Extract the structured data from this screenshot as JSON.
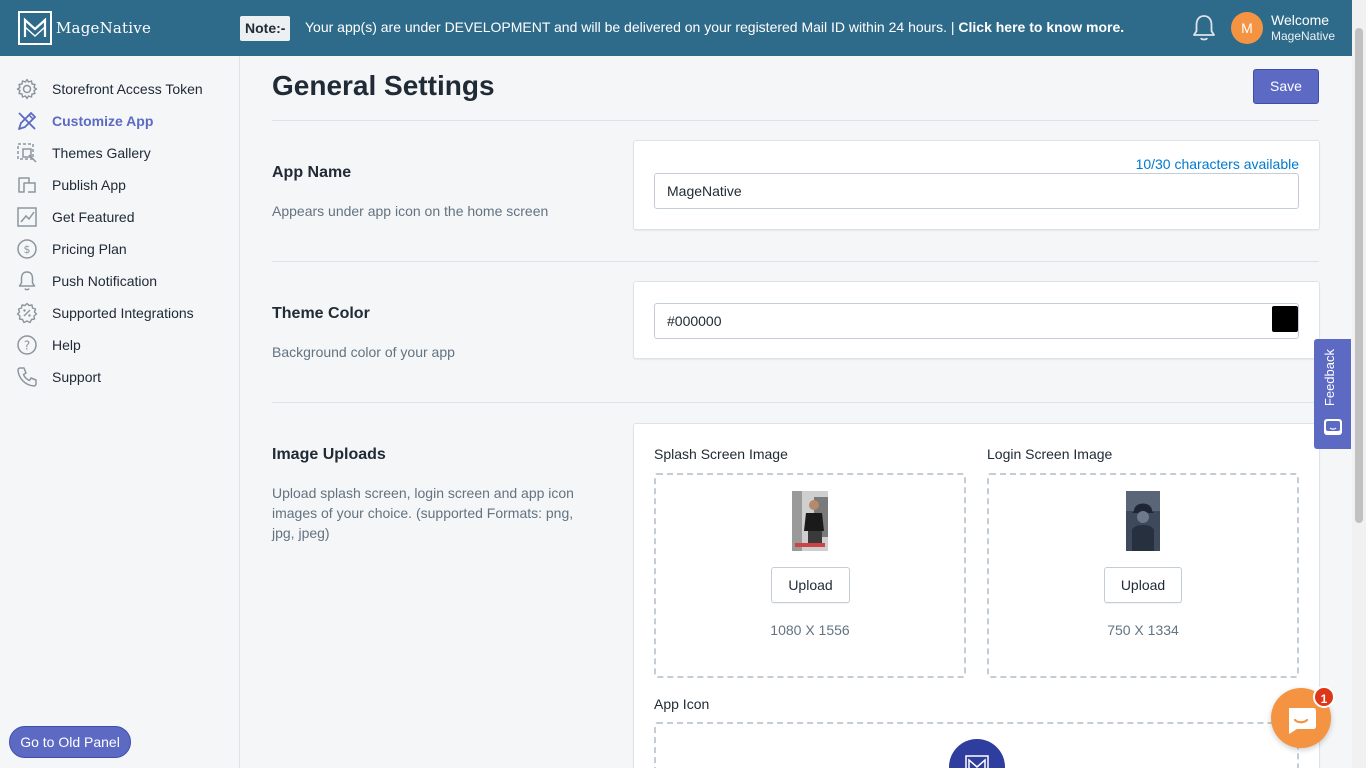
{
  "brand": {
    "logo_text": "MageNative"
  },
  "header": {
    "note_tag": "Note:-",
    "note_text": "Your app(s) are under DEVELOPMENT and will be delivered on your registered Mail ID within 24 hours. |",
    "note_link": "Click here to know more.",
    "avatar_initial": "M",
    "welcome_line1": "Welcome",
    "welcome_line2": "MageNative"
  },
  "sidebar": {
    "items": [
      {
        "label": "Storefront Access Token",
        "icon": "gear-icon",
        "active": false
      },
      {
        "label": "Customize App",
        "icon": "brush-icon",
        "active": true
      },
      {
        "label": "Themes Gallery",
        "icon": "gallery-icon",
        "active": false
      },
      {
        "label": "Publish App",
        "icon": "publish-icon",
        "active": false
      },
      {
        "label": "Get Featured",
        "icon": "chart-icon",
        "active": false
      },
      {
        "label": "Pricing Plan",
        "icon": "dollar-icon",
        "active": false
      },
      {
        "label": "Push Notification",
        "icon": "bell-icon",
        "active": false
      },
      {
        "label": "Supported Integrations",
        "icon": "integration-icon",
        "active": false
      },
      {
        "label": "Help",
        "icon": "help-icon",
        "active": false
      },
      {
        "label": "Support",
        "icon": "phone-icon",
        "active": false
      }
    ],
    "old_panel_label": "Go to Old Panel"
  },
  "main": {
    "title": "General Settings",
    "save_label": "Save",
    "app_name": {
      "title": "App Name",
      "description": "Appears under app icon on the home screen",
      "chars_available": "10/30 characters available",
      "value": "MageNative"
    },
    "theme_color": {
      "title": "Theme Color",
      "description": "Background color of your app",
      "value": "#000000",
      "swatch_color": "#000000"
    },
    "image_uploads": {
      "title": "Image Uploads",
      "description": "Upload splash screen, login screen and app icon images of your choice. (supported Formats: png, jpg, jpeg)",
      "splash": {
        "label": "Splash Screen Image",
        "button": "Upload",
        "dims": "1080 X 1556"
      },
      "login": {
        "label": "Login Screen Image",
        "button": "Upload",
        "dims": "750 X 1334"
      },
      "app_icon": {
        "label": "App Icon"
      }
    }
  },
  "feedback": {
    "label": "Feedback"
  },
  "chat": {
    "badge": "1"
  },
  "colors": {
    "topbar": "#2e6b8a",
    "accent": "#5c6ac4",
    "chat": "#f49342",
    "badge": "#de3618"
  }
}
